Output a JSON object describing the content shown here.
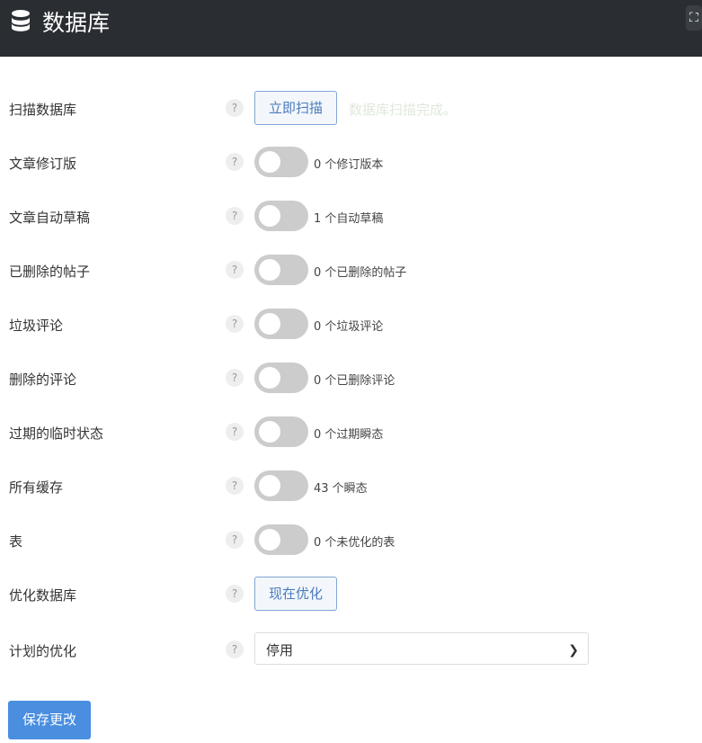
{
  "header": {
    "title": "数据库",
    "icon": "database-icon",
    "fullscreen_icon": "fullscreen-icon"
  },
  "scan": {
    "label": "扫描数据库",
    "button": "立即扫描",
    "status": "数据库扫描完成。"
  },
  "toggles": [
    {
      "label": "文章修订版",
      "count": "0 个修订版本",
      "on": false
    },
    {
      "label": "文章自动草稿",
      "count": "1 个自动草稿",
      "on": false
    },
    {
      "label": "已删除的帖子",
      "count": "0 个已删除的帖子",
      "on": false
    },
    {
      "label": "垃圾评论",
      "count": "0 个垃圾评论",
      "on": false
    },
    {
      "label": "删除的评论",
      "count": "0 个已删除评论",
      "on": false
    },
    {
      "label": "过期的临时状态",
      "count": "0 个过期瞬态",
      "on": false
    },
    {
      "label": "所有缓存",
      "count": "43 个瞬态",
      "on": false
    },
    {
      "label": "表",
      "count": "0 个未优化的表",
      "on": false
    }
  ],
  "optimize": {
    "label": "优化数据库",
    "button": "现在优化"
  },
  "schedule": {
    "label": "计划的优化",
    "value": "停用"
  },
  "help": "?",
  "save": "保存更改"
}
